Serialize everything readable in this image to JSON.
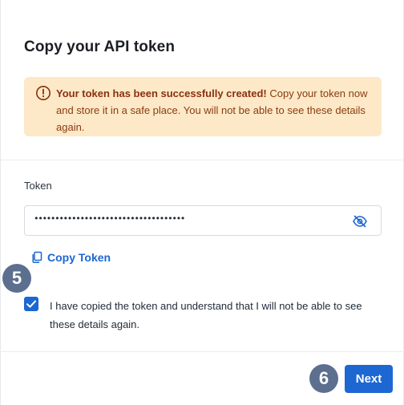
{
  "dialog": {
    "title": "Copy your API token"
  },
  "alert": {
    "bold_text": "Your token has been successfully created!",
    "body_text": " Copy your token now and store it in a safe place. You will not be able to see these details again.",
    "icon": "warning-circle-icon",
    "background_color": "#fde9c7",
    "text_color": "#8a3c12"
  },
  "token": {
    "label": "Token",
    "masked_value": "••••••••••••••••••••••••••••••••••••",
    "visibility_icon": "eye-off-icon"
  },
  "copy_link": {
    "label": "Copy Token",
    "icon": "copy-icon"
  },
  "confirmation": {
    "checked": true,
    "text": "I have copied the token and understand that I will not be able to see these details again."
  },
  "footer": {
    "next_label": "Next"
  },
  "step_badges": {
    "copy_step": "5",
    "next_step": "6"
  },
  "colors": {
    "accent": "#1c67d2",
    "badge": "#5d6f8f"
  }
}
